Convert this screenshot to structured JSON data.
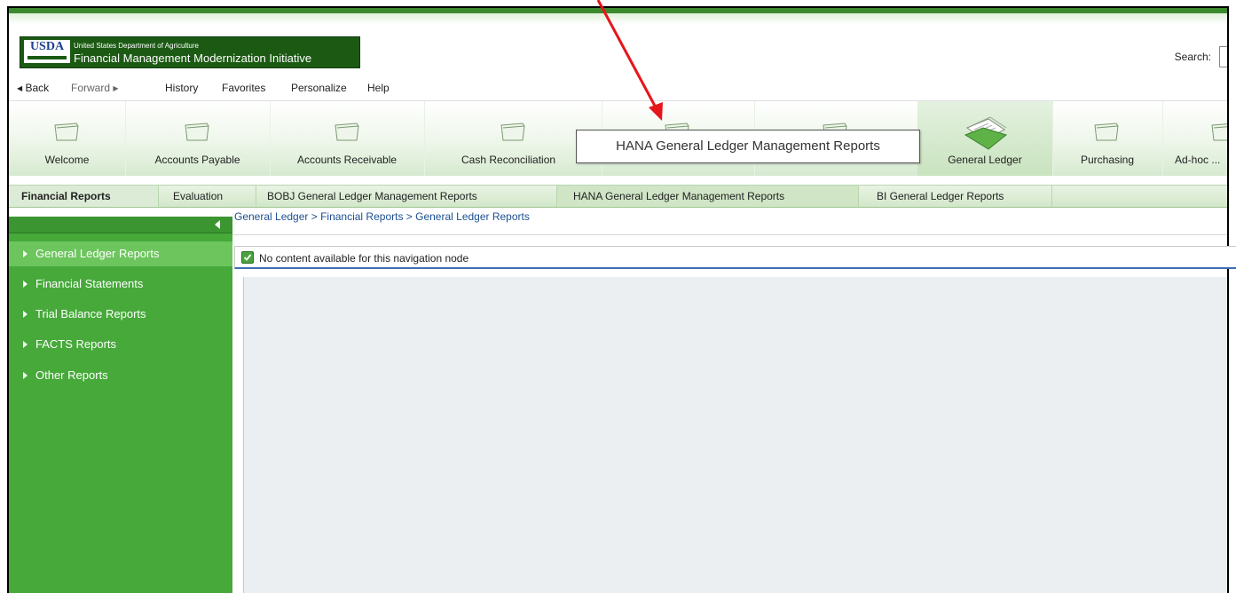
{
  "header": {
    "logo_usda": "USDA",
    "logo_line1": "United States Department of Agriculture",
    "logo_line2": "Financial Management Modernization Initiative",
    "search_label": "Search:"
  },
  "toolbar": {
    "back": "Back",
    "forward": "Forward",
    "history": "History",
    "favorites": "Favorites",
    "personalize": "Personalize",
    "help": "Help"
  },
  "tabs": [
    {
      "label": "Welcome"
    },
    {
      "label": "Accounts Payable"
    },
    {
      "label": "Accounts Receivable"
    },
    {
      "label": "Cash Reconciliation"
    },
    {
      "label": ""
    },
    {
      "label": ""
    },
    {
      "label": "General Ledger"
    },
    {
      "label": "Purchasing"
    },
    {
      "label": "Ad-hoc ..."
    }
  ],
  "tooltip": "HANA General Ledger Management Reports",
  "subnav": {
    "items": [
      "Financial Reports",
      "Evaluation",
      "BOBJ General Ledger Management Reports",
      "HANA General Ledger Management Reports",
      "BI General Ledger Reports"
    ]
  },
  "sidebar": {
    "items": [
      {
        "label": "General Ledger Reports"
      },
      {
        "label": "Financial Statements"
      },
      {
        "label": "Trial Balance Reports"
      },
      {
        "label": "FACTS Reports"
      },
      {
        "label": "Other Reports"
      }
    ]
  },
  "breadcrumb": "General Ledger  >  Financial Reports  >  General Ledger Reports",
  "content": {
    "message": "No content available for this navigation node"
  },
  "colors": {
    "accent_green": "#46a93a",
    "annotation_red": "#e8141c"
  }
}
